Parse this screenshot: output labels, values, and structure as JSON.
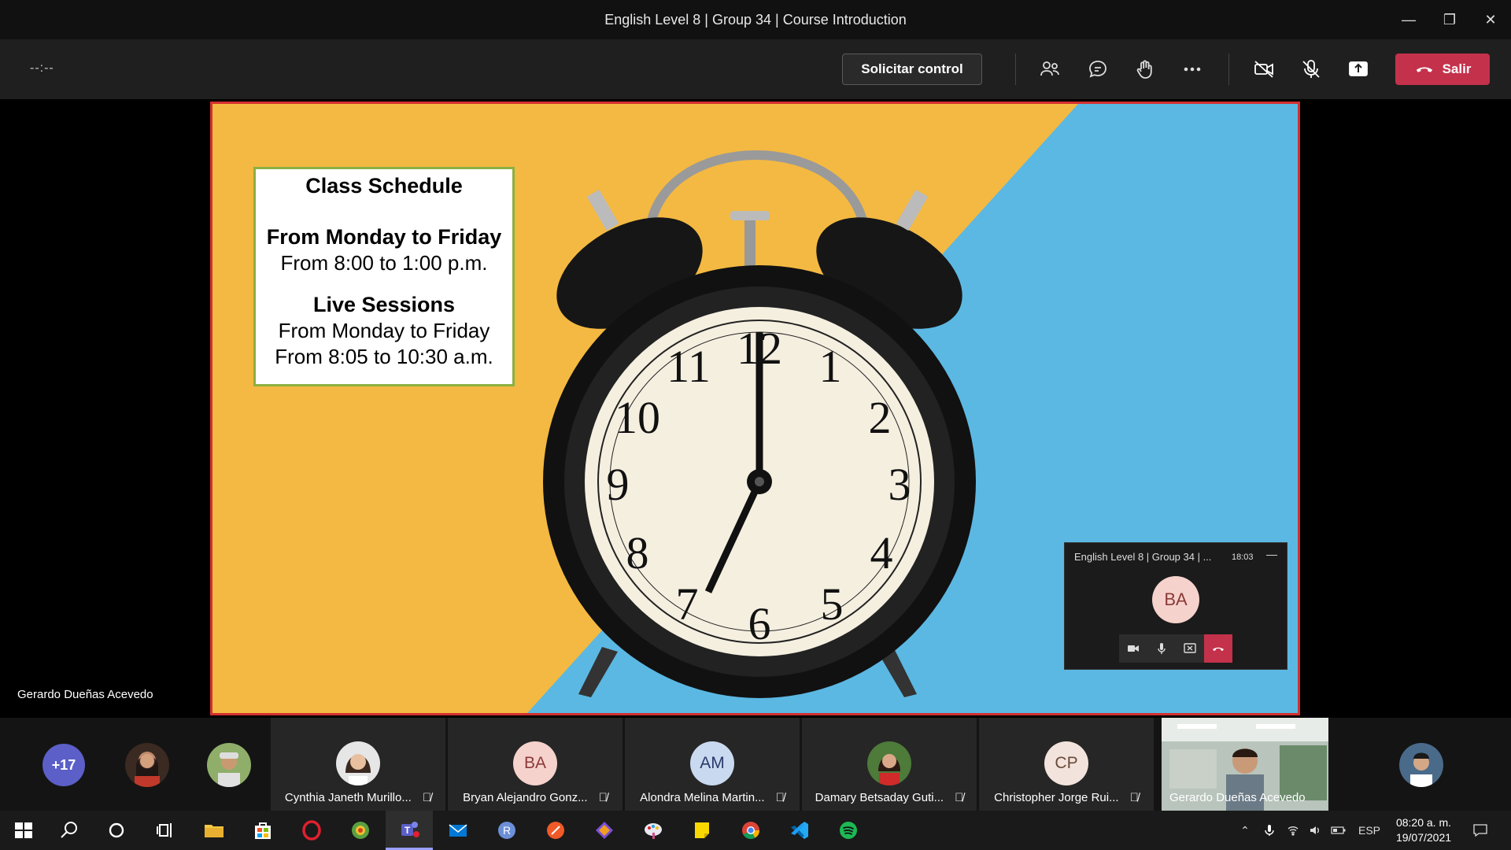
{
  "window": {
    "title": "English Level 8 | Group 34 | Course Introduction",
    "minimize": "—",
    "restore": "❐",
    "close": "✕"
  },
  "toolbar": {
    "timer": "--:--",
    "request_control": "Solicitar control",
    "leave_label": "Salir"
  },
  "stage": {
    "presenter_name": "Gerardo Dueñas Acevedo",
    "slide": {
      "title": "Class Schedule",
      "line1": "From Monday to Friday",
      "line2": "From 8:00 to 1:00 p.m.",
      "title2": "Live Sessions",
      "line3": "From Monday to Friday",
      "line4": "From 8:05 to 10:30 a.m."
    }
  },
  "mini_window": {
    "title": "English Level 8 | Group 34 | ...",
    "time": "18:03",
    "minimize": "—",
    "avatar_initials": "BA"
  },
  "participants": {
    "overflow_count": "+17",
    "tiles": [
      {
        "name": "Cynthia Janeth Murillo...",
        "initials": ""
      },
      {
        "name": "Bryan Alejandro Gonz...",
        "initials": "BA"
      },
      {
        "name": "Alondra Melina Martin...",
        "initials": "AM"
      },
      {
        "name": "Damary Betsaday Guti...",
        "initials": ""
      },
      {
        "name": "Christopher Jorge Rui...",
        "initials": "CP"
      },
      {
        "name": "Gerardo Dueñas Acevedo",
        "initials": ""
      }
    ]
  },
  "taskbar": {
    "language": "ESP",
    "time": "08:20 a. m.",
    "date": "19/07/2021"
  },
  "colors": {
    "leave_red": "#c4314b",
    "teams_purple": "#5b5fc7",
    "share_border": "#d32f2f",
    "slide_yellow": "#f4b942",
    "slide_blue": "#5bb8e3"
  }
}
